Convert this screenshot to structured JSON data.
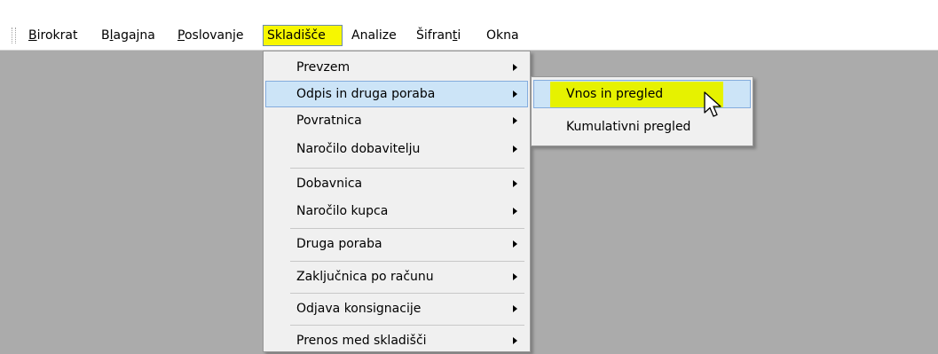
{
  "menubar": {
    "items": [
      {
        "pre": "",
        "u": "B",
        "post": "irokrat"
      },
      {
        "pre": "B",
        "u": "l",
        "post": "agajna"
      },
      {
        "pre": "",
        "u": "P",
        "post": "oslovanje"
      },
      {
        "pre": "",
        "u": "",
        "post": "Skladišče"
      },
      {
        "pre": "",
        "u": "",
        "post": "Analize"
      },
      {
        "pre": "Šifran",
        "u": "t",
        "post": "i"
      },
      {
        "pre": "",
        "u": "",
        "post": "Okna"
      }
    ]
  },
  "dropdown": {
    "items": [
      "Prevzem",
      "Odpis in druga poraba",
      "Povratnica",
      "Naročilo dobavitelju",
      "Dobavnica",
      "Naročilo kupca",
      "Druga poraba",
      "Zaključnica po računu",
      "Odjava konsignacije",
      "Prenos med skladišči"
    ]
  },
  "submenu": {
    "items": [
      "Vnos in pregled",
      "Kumulativni pregled"
    ]
  },
  "colors": {
    "highlight_yellow": "#f7f700",
    "selection_blue": "#cce4f7",
    "workspace_gray": "#ababab"
  },
  "icons": {
    "cursor": "arrow-cursor-icon",
    "submenu_arrow": "chevron-right-icon"
  }
}
